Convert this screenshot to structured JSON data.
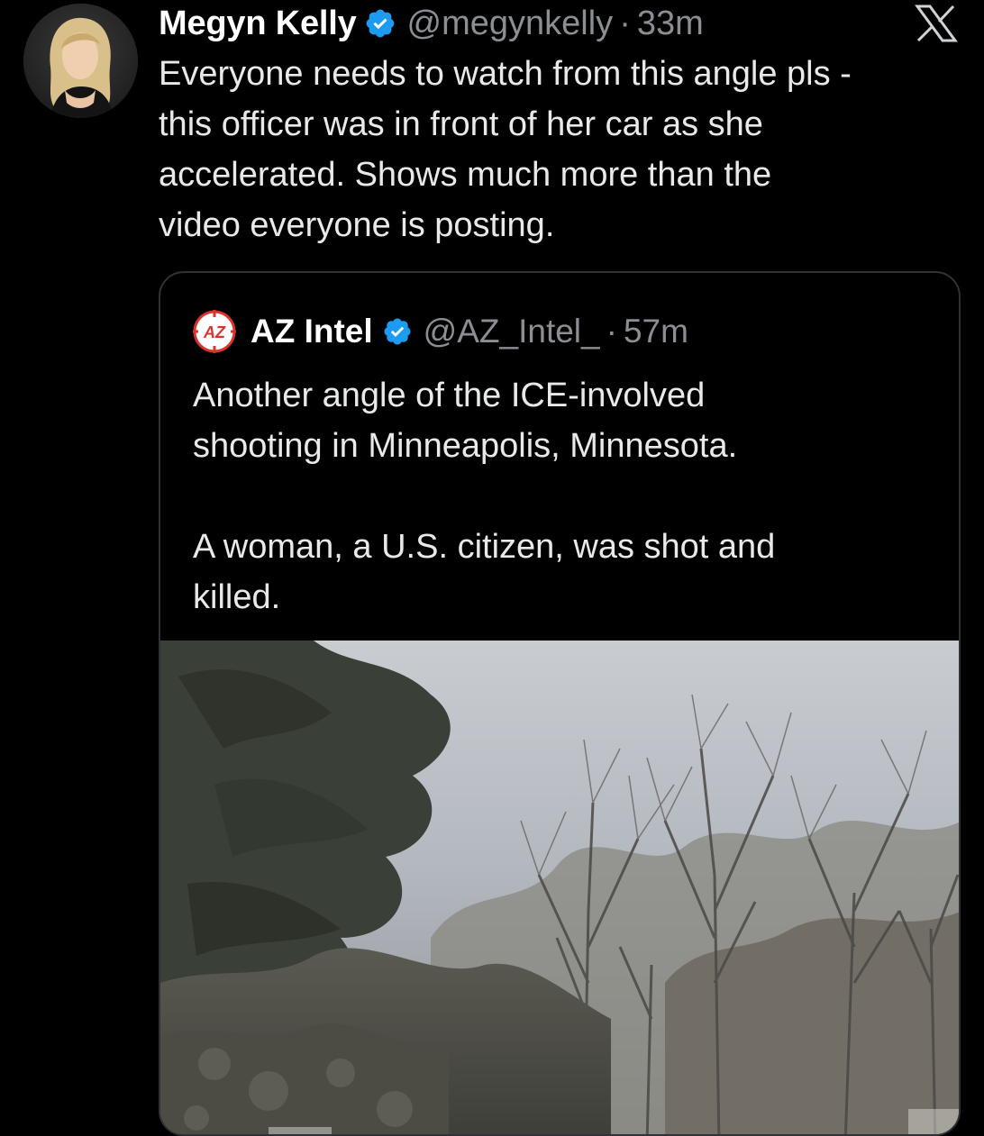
{
  "tweet": {
    "display_name": "Megyn Kelly",
    "handle": "@megynkelly",
    "separator": "·",
    "time": "33m",
    "text": "Everyone needs to watch from this angle pls -\nthis officer was in front of her car as she\naccelerated. Shows much more than the\nvideo everyone is posting.",
    "verified_color": "#1d9bf0"
  },
  "quoted_tweet": {
    "avatar_text": "AZ",
    "display_name": "AZ Intel",
    "handle": "@AZ_Intel_",
    "separator": "·",
    "time": "57m",
    "text": "Another angle of the ICE-involved\nshooting in Minneapolis, Minnesota.\n\nA woman, a U.S. citizen, was shot and\nkilled."
  },
  "colors": {
    "background": "#000000",
    "primary_text": "#e7e9ea",
    "secondary_text": "#8b8f94",
    "card_border": "#2f3336",
    "accent": "#1d9bf0",
    "az_red": "#d9342b"
  },
  "icons": {
    "verified": "verified-badge-icon",
    "platform_logo": "x-logo-icon"
  }
}
